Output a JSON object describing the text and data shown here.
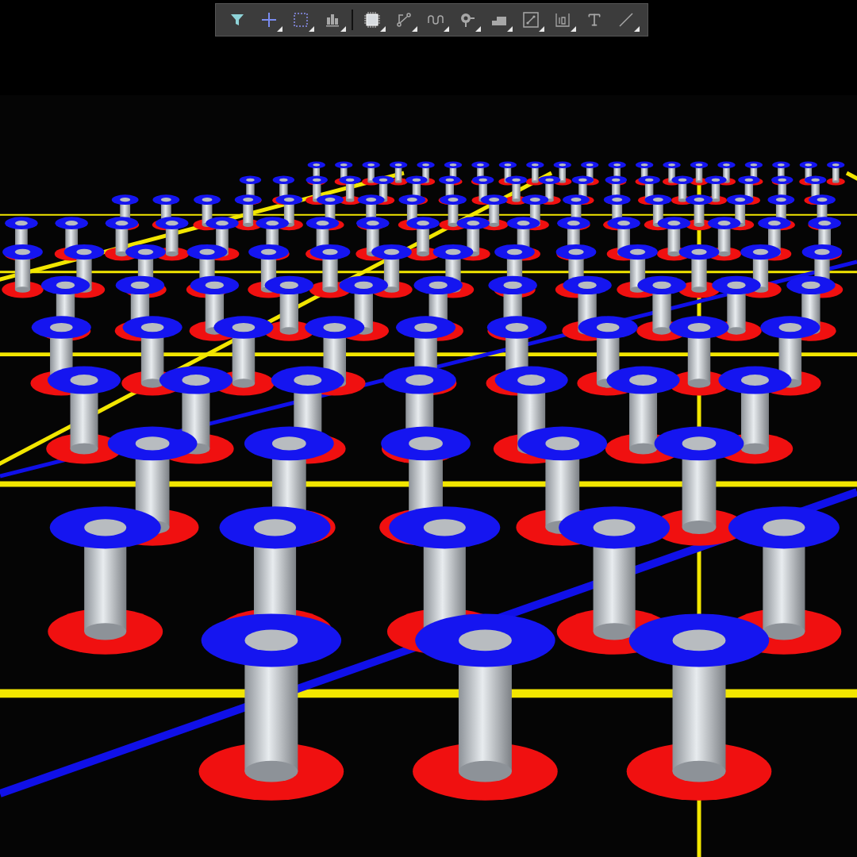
{
  "toolbar": {
    "groups": [
      {
        "tools": [
          {
            "kind": "filter",
            "has_menu": false
          },
          {
            "kind": "cross",
            "has_menu": true
          },
          {
            "kind": "select",
            "has_menu": true
          },
          {
            "kind": "align",
            "has_menu": true
          }
        ]
      },
      {
        "tools": [
          {
            "kind": "component",
            "has_menu": true
          },
          {
            "kind": "route",
            "has_menu": true
          },
          {
            "kind": "tune",
            "has_menu": true
          },
          {
            "kind": "pad",
            "has_menu": true
          },
          {
            "kind": "polygon",
            "has_menu": true
          },
          {
            "kind": "keepout",
            "has_menu": true
          },
          {
            "kind": "dimension",
            "has_menu": true
          },
          {
            "kind": "text",
            "has_menu": false
          },
          {
            "kind": "line",
            "has_menu": true
          }
        ]
      }
    ]
  }
}
